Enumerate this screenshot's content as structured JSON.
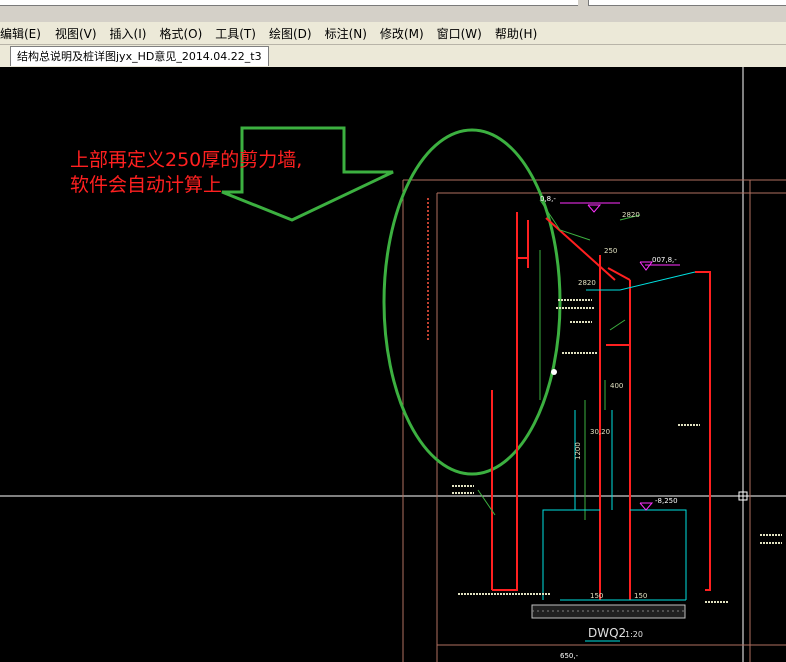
{
  "menu": [
    {
      "label": "编辑(E)",
      "name": "menu-edit"
    },
    {
      "label": "视图(V)",
      "name": "menu-view"
    },
    {
      "label": "插入(I)",
      "name": "menu-insert"
    },
    {
      "label": "格式(O)",
      "name": "menu-format"
    },
    {
      "label": "工具(T)",
      "name": "menu-tools"
    },
    {
      "label": "绘图(D)",
      "name": "menu-draw"
    },
    {
      "label": "标注(N)",
      "name": "menu-dimension"
    },
    {
      "label": "修改(M)",
      "name": "menu-modify"
    },
    {
      "label": "窗口(W)",
      "name": "menu-window"
    },
    {
      "label": "帮助(H)",
      "name": "menu-help"
    }
  ],
  "tab": {
    "label": "结构总说明及桩详图jyx_HD意见_2014.04.22_t3"
  },
  "annotation": {
    "line1": "上部再定义250厚的剪力墙,",
    "line2": "软件会自动计算上",
    "color": "#ff2020"
  },
  "drawing": {
    "dims": {
      "d2820a": "2820",
      "d250": "250",
      "d2820b": "2820",
      "d400": "400",
      "d3020": "30,20",
      "d1200": "1200",
      "d150a": "150",
      "d150b": "150"
    },
    "elev": {
      "top": "0,8,-",
      "right": "007,8,-",
      "mid": "-8,250",
      "bottom": "650,-"
    },
    "caption": {
      "title": "DWQ2",
      "scale": "1:20"
    },
    "colors": {
      "red": "#ff2020",
      "green": "#3cb040",
      "cyan": "#00e0e0",
      "frame": "#b07060",
      "magenta": "#ff30ff"
    }
  }
}
